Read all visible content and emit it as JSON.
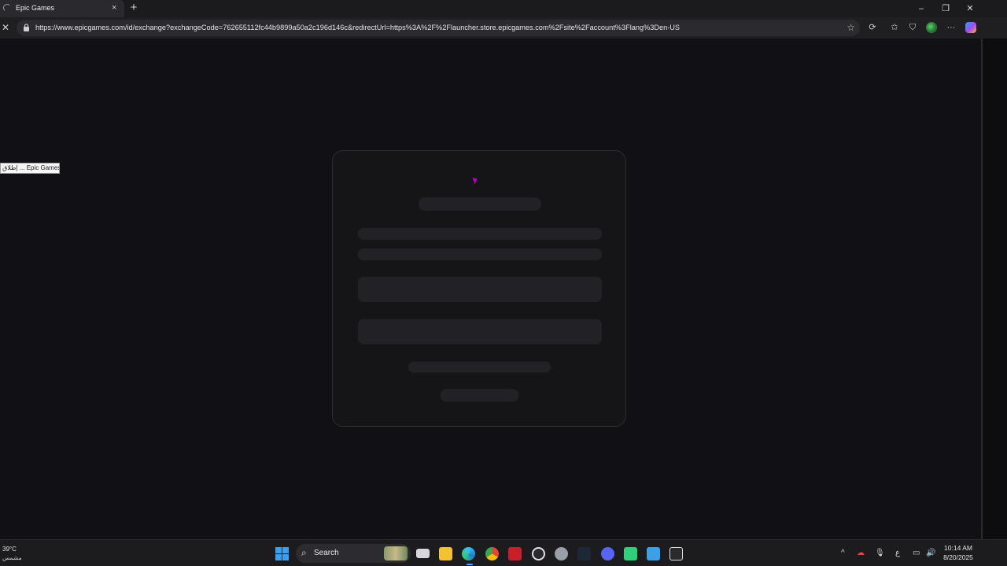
{
  "browser": {
    "tab_title": "Epic Games",
    "tab_close": "×",
    "new_tab": "+",
    "url": "https://www.epicgames.com/id/exchange?exchangeCode=762655112fc44b9899a50a2c196d146c&redirectUrl=https%3A%2F%2Flauncher.store.epicgames.com%2Fsite%2Faccount%3Flang%3Den-US",
    "window_controls": {
      "minimize": "–",
      "restore": "❐",
      "close": "✕"
    },
    "stop": "✕",
    "toolbar_icons": [
      "star-icon",
      "extensions-icon",
      "favorites-icon",
      "shield-icon",
      "profile-icon",
      "more-icon",
      "copilot-icon"
    ],
    "more": "···"
  },
  "page": {
    "tooltip": "إطلاق ... Epic Games"
  },
  "taskbar": {
    "weather_temp": "39°C",
    "weather_desc": "مشمس",
    "search_label": "Search",
    "clock_time": "10:14 AM",
    "clock_date": "8/20/2025",
    "tray_lang": "ع",
    "tray_overflow": "^"
  }
}
